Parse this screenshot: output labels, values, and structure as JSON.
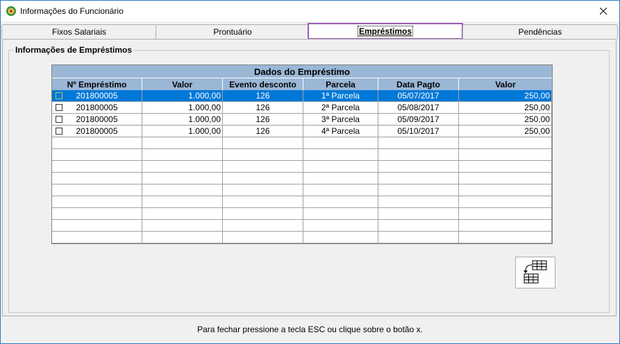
{
  "window": {
    "title": "Informações do Funcionário"
  },
  "tabs": [
    {
      "label": "Fixos Salariais",
      "active": false
    },
    {
      "label": "Prontuário",
      "active": false
    },
    {
      "label": "Empréstimos",
      "active": true
    },
    {
      "label": "Pendências",
      "active": false
    }
  ],
  "group": {
    "label": "Informações de Empréstimos"
  },
  "grid": {
    "title": "Dados do Empréstimo",
    "columns": [
      "Nº Empréstimo",
      "Valor",
      "Evento desconto",
      "Parcela",
      "Data Pagto",
      "Valor"
    ],
    "rows": [
      {
        "numero": "201800005",
        "valor": "1.000,00",
        "evento": "126",
        "parcela": "1ª Parcela",
        "data": "05/07/2017",
        "valor_parcela": "250,00",
        "selected": true,
        "checked": false
      },
      {
        "numero": "201800005",
        "valor": "1.000,00",
        "evento": "126",
        "parcela": "2ª Parcela",
        "data": "05/08/2017",
        "valor_parcela": "250,00",
        "selected": false,
        "checked": false
      },
      {
        "numero": "201800005",
        "valor": "1.000,00",
        "evento": "126",
        "parcela": "3ª Parcela",
        "data": "05/09/2017",
        "valor_parcela": "250,00",
        "selected": false,
        "checked": false
      },
      {
        "numero": "201800005",
        "valor": "1.000,00",
        "evento": "126",
        "parcela": "4ª Parcela",
        "data": "05/10/2017",
        "valor_parcela": "250,00",
        "selected": false,
        "checked": false
      }
    ]
  },
  "export_button": {
    "icon": "grid-export-icon"
  },
  "status": {
    "text": "Para fechar pressione a tecla ESC ou clique sobre o botão x."
  },
  "colors": {
    "header_bg": "#9ab7d6",
    "selection": "#0078d7",
    "active_tab_border": "#9b59b6"
  }
}
